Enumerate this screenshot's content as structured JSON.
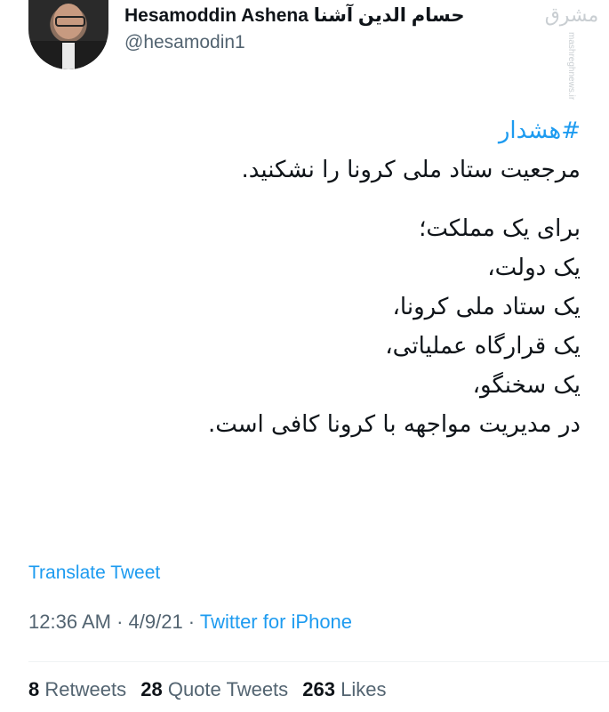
{
  "author": {
    "display_name": "Hesamoddin Ashena حسام الدین آشنا",
    "handle": "@hesamodin1"
  },
  "watermark": {
    "logo": "مشرق",
    "url": "mashreghnews.ir"
  },
  "tweet": {
    "hashtag": "#هشدار",
    "lines": [
      "مرجعیت ستاد ملی کرونا را نشکنید.",
      "برای یک مملکت؛",
      "یک دولت،",
      "یک ستاد ملی کرونا،",
      "یک قرارگاه عملیاتی،",
      "یک سخنگو،",
      "در مدیریت مواجهه با کرونا کافی است."
    ]
  },
  "translate_label": "Translate Tweet",
  "meta": {
    "time": "12:36 AM",
    "date": "4/9/21",
    "source": "Twitter for iPhone",
    "sep": " · "
  },
  "stats": {
    "retweets_count": "8",
    "retweets_label": "Retweets",
    "quotes_count": "28",
    "quotes_label": "Quote Tweets",
    "likes_count": "263",
    "likes_label": "Likes"
  },
  "colors": {
    "link": "#1d9bf0",
    "secondary": "#536471",
    "text": "#0f1419"
  }
}
